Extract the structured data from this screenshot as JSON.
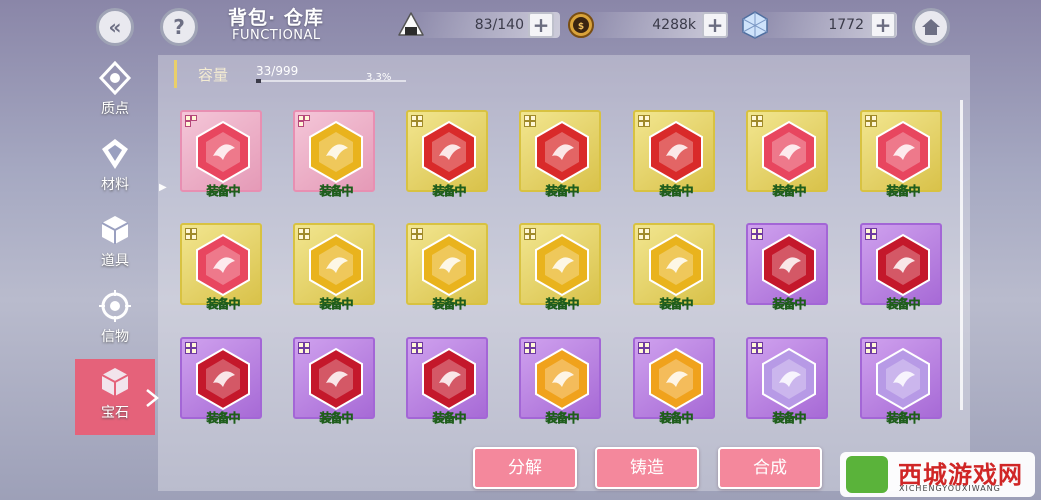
{
  "header": {
    "title_cn": "背包· 仓库",
    "title_en": "FUNCTIONAL",
    "resources": [
      {
        "icon": "rice-ball-icon",
        "value": "83/140"
      },
      {
        "icon": "gold-coin-icon",
        "value": "4288k"
      },
      {
        "icon": "crystal-cube-icon",
        "value": "1772"
      }
    ]
  },
  "sidebar": {
    "items": [
      {
        "label": "质点",
        "icon": "particle-icon"
      },
      {
        "label": "材料",
        "icon": "material-icon"
      },
      {
        "label": "道具",
        "icon": "item-box-icon"
      },
      {
        "label": "信物",
        "icon": "token-icon"
      },
      {
        "label": "宝石",
        "icon": "gem-icon"
      }
    ],
    "active_index": 4
  },
  "capacity": {
    "label": "容量",
    "count": "33/999",
    "percent": "3.3%",
    "fill_fraction": 0.033
  },
  "gems": {
    "equipped_label": "装备中",
    "rows": [
      [
        {
          "frame": "pink",
          "color": "#e8465f",
          "pips": 2,
          "equipped": true
        },
        {
          "frame": "pink",
          "color": "#e9b31d",
          "pips": 2,
          "equipped": true
        },
        {
          "frame": "gold",
          "color": "#d92a2a",
          "pips": 3,
          "equipped": true
        },
        {
          "frame": "gold",
          "color": "#d92a2a",
          "pips": 3,
          "equipped": true
        },
        {
          "frame": "gold",
          "color": "#d92a2a",
          "pips": 3,
          "equipped": true
        },
        {
          "frame": "gold",
          "color": "#e8465f",
          "pips": 3,
          "equipped": true
        },
        {
          "frame": "gold",
          "color": "#e8465f",
          "pips": 3,
          "equipped": true
        }
      ],
      [
        {
          "frame": "gold",
          "color": "#e8465f",
          "pips": 3,
          "equipped": true
        },
        {
          "frame": "gold",
          "color": "#e9b31d",
          "pips": 3,
          "equipped": true
        },
        {
          "frame": "gold",
          "color": "#e9b31d",
          "pips": 3,
          "equipped": true
        },
        {
          "frame": "gold",
          "color": "#e9b31d",
          "pips": 3,
          "equipped": true
        },
        {
          "frame": "gold",
          "color": "#e9b31d",
          "pips": 3,
          "equipped": true
        },
        {
          "frame": "purple",
          "color": "#c4182b",
          "pips": 3,
          "equipped": true
        },
        {
          "frame": "purple",
          "color": "#c4182b",
          "pips": 3,
          "equipped": true
        }
      ],
      [
        {
          "frame": "purple",
          "color": "#c4182b",
          "pips": 3,
          "equipped": true
        },
        {
          "frame": "purple",
          "color": "#c4182b",
          "pips": 3,
          "equipped": true
        },
        {
          "frame": "purple",
          "color": "#c4182b",
          "pips": 3,
          "equipped": true
        },
        {
          "frame": "purple",
          "color": "#f0a21c",
          "pips": 3,
          "equipped": true
        },
        {
          "frame": "purple",
          "color": "#f0a21c",
          "pips": 3,
          "equipped": true
        },
        {
          "frame": "purple",
          "color": "#b79ae6",
          "pips": 3,
          "equipped": true
        },
        {
          "frame": "purple",
          "color": "#b79ae6",
          "pips": 3,
          "equipped": true
        }
      ]
    ]
  },
  "actions": {
    "dismantle": "分解",
    "forge": "铸造",
    "synthesize": "合成"
  },
  "watermark": {
    "cn": "西城游戏网",
    "en": "XICHENGYOUXIWANG"
  }
}
